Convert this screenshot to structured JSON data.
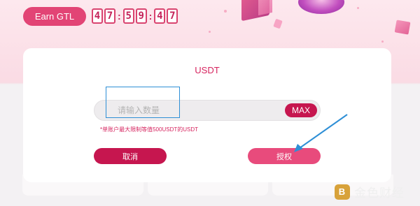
{
  "header": {
    "earn_button_label": "Earn GTL",
    "countdown": {
      "h1": "4",
      "h2": "7",
      "m1": "5",
      "m2": "9",
      "s1": "4",
      "s2": "7",
      "separator": ":"
    }
  },
  "modal": {
    "title": "USDT",
    "amount_input": {
      "placeholder": "请输入数量",
      "value": ""
    },
    "max_label": "MAX",
    "hint": "*单账户最大限制等值500USDT的USDT",
    "cancel_label": "取消",
    "confirm_label": "授权"
  },
  "watermark": {
    "logo_glyph": "B",
    "text": "金色财经"
  },
  "colors": {
    "accent": "#e24475",
    "primary_dark": "#c6164f",
    "annotation": "#2e8fd6"
  }
}
